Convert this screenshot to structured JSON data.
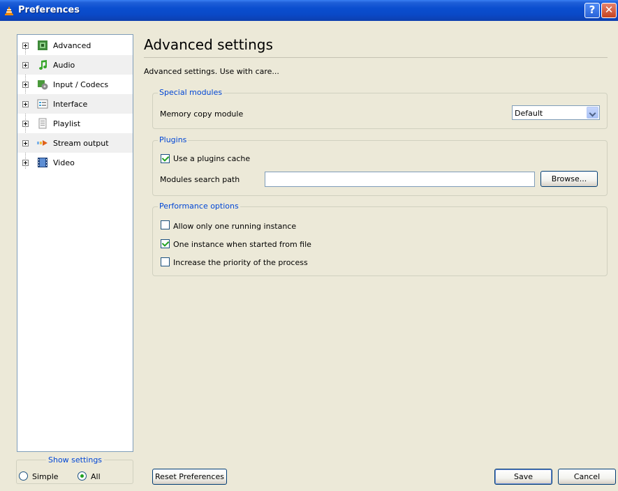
{
  "window": {
    "title": "Preferences"
  },
  "tree": {
    "items": [
      {
        "label": "Advanced",
        "icon": "chip-icon"
      },
      {
        "label": "Audio",
        "icon": "music-note-icon"
      },
      {
        "label": "Input / Codecs",
        "icon": "codecs-icon"
      },
      {
        "label": "Interface",
        "icon": "interface-icon"
      },
      {
        "label": "Playlist",
        "icon": "playlist-icon"
      },
      {
        "label": "Stream output",
        "icon": "stream-output-icon"
      },
      {
        "label": "Video",
        "icon": "film-icon"
      }
    ]
  },
  "show_settings": {
    "title": "Show settings",
    "simple_label": "Simple",
    "all_label": "All",
    "selected": "All"
  },
  "main": {
    "heading": "Advanced settings",
    "description": "Advanced settings. Use with care...",
    "special_modules": {
      "title": "Special modules",
      "memory_copy_label": "Memory copy module",
      "memory_copy_value": "Default"
    },
    "plugins": {
      "title": "Plugins",
      "use_cache_label": "Use a plugins cache",
      "use_cache_checked": true,
      "search_path_label": "Modules search path",
      "search_path_value": "",
      "browse_label": "Browse..."
    },
    "performance": {
      "title": "Performance options",
      "one_instance_label": "Allow only one running instance",
      "one_instance_checked": false,
      "one_instance_file_label": "One instance when started from file",
      "one_instance_file_checked": true,
      "priority_label": "Increase the priority of the process",
      "priority_checked": false
    }
  },
  "footer": {
    "reset_label": "Reset Preferences",
    "save_label": "Save",
    "cancel_label": "Cancel"
  }
}
